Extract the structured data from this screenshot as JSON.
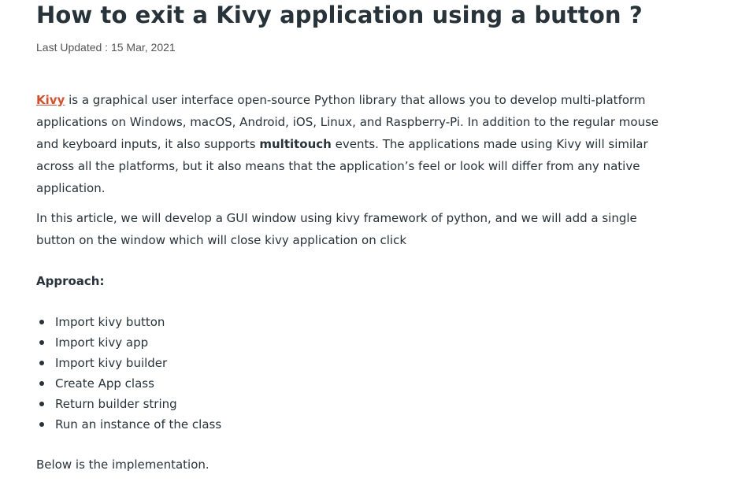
{
  "article": {
    "title": "How to exit a Kivy application using a button ?",
    "last_updated_label": "Last Updated : ",
    "last_updated_date": "15 Mar, 2021",
    "intro": {
      "link_text": "Kivy",
      "text_before_bold": " is a graphical user interface open-source Python library that allows you to develop multi-platform applications on Windows, macOS, Android, iOS, Linux, and Raspberry-Pi. In addition to the regular mouse and keyboard inputs, it also supports ",
      "bold_text": "multitouch",
      "text_after_bold": " events. The applications made using Kivy will similar across all the platforms, but it also means that the application’s feel or look will differ from any native application."
    },
    "para2": "In this article, we will develop a GUI window using kivy framework of python, and we will add a single button on the window which will close kivy application on click",
    "approach_heading": "Approach:",
    "steps": [
      "Import kivy button",
      "Import kivy app",
      "Import kivy builder",
      "Create App class",
      "Return builder string",
      "Run an instance of the class"
    ],
    "closing": "Below is the implementation."
  },
  "colors": {
    "text": "#273239",
    "link": "#d1512e",
    "meta": "#555555"
  }
}
